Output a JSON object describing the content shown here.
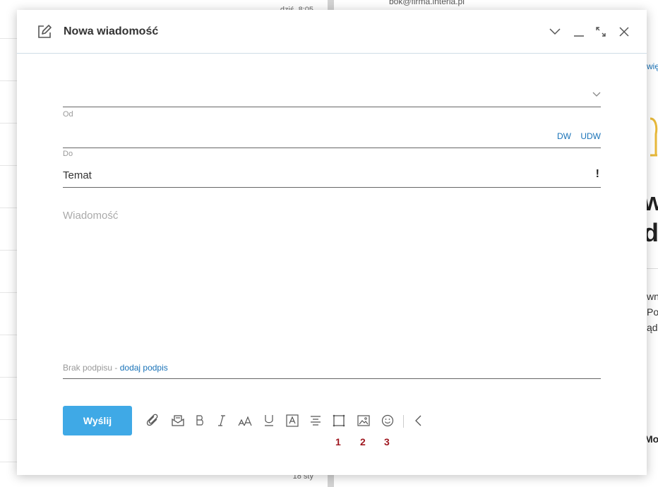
{
  "background": {
    "time_top": "dziś, 8:05",
    "time_bottom": "18 sty",
    "email": "bok@firma.interia.pl",
    "more_link": "więcej",
    "big_line_1": "wa",
    "big_line_2": "dz",
    "text_line_1": "wni",
    "text_line_2": "Po",
    "text_line_3": "ądz",
    "bold_text": "Mo"
  },
  "compose": {
    "title": "Nowa wiadomość",
    "from_label": "Od",
    "to_label": "Do",
    "cc_label": "DW",
    "bcc_label": "UDW",
    "subject_placeholder": "Temat",
    "priority_label": "!",
    "message_placeholder": "Wiadomość",
    "signature_text": "Brak podpisu -",
    "signature_link": "dodaj podpis",
    "send_label": "Wyślij"
  },
  "toolbar_icons": [
    "attachment-icon",
    "mail-template-icon",
    "bold-icon",
    "italic-icon",
    "font-size-icon",
    "underline-icon",
    "text-color-icon",
    "align-icon",
    "frame-icon",
    "image-icon",
    "emoji-icon",
    "chevron-left-icon"
  ],
  "annotations": {
    "n1": "1",
    "n2": "2",
    "n3": "3"
  },
  "colors": {
    "accent": "#3fa9e6",
    "link": "#1a73b8",
    "annotation": "#a01820"
  }
}
